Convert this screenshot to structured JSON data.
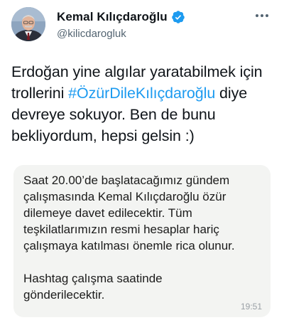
{
  "author": {
    "display_name": "Kemal Kılıçdaroğlu",
    "handle": "@kilicdarogluk"
  },
  "tweet": {
    "line1": "Erdoğan yine algılar yaratabilmek için",
    "line2_pre": "trollerini ",
    "line2_hashtag": "#ÖzürDileKılıçdaroğlu",
    "line2_post": " diye",
    "line3": "devreye sokuyor. Ben de bunu",
    "line4": "bekliyordum, hepsi gelsin :)"
  },
  "quoted_message": {
    "lines": [
      "Saat 20.00’de başlatacağımız gündem",
      "çalışmasında Kemal Kılıçdaroğlu özür",
      "dilemeye davet edilecektir.  Tüm",
      "teşkilatlarımızın resmi hesaplar hariç",
      "çalışmaya katılması önemle rica olunur."
    ],
    "lines_after": [
      "Hashtag çalışma saatinde",
      "gönderilecektir."
    ],
    "time": "19:51"
  },
  "colors": {
    "text": "#0f1419",
    "secondary": "#536471",
    "hashtag": "#1d9bf0",
    "verified": "#1d9bf0",
    "card_bg": "#f3f4f2"
  }
}
